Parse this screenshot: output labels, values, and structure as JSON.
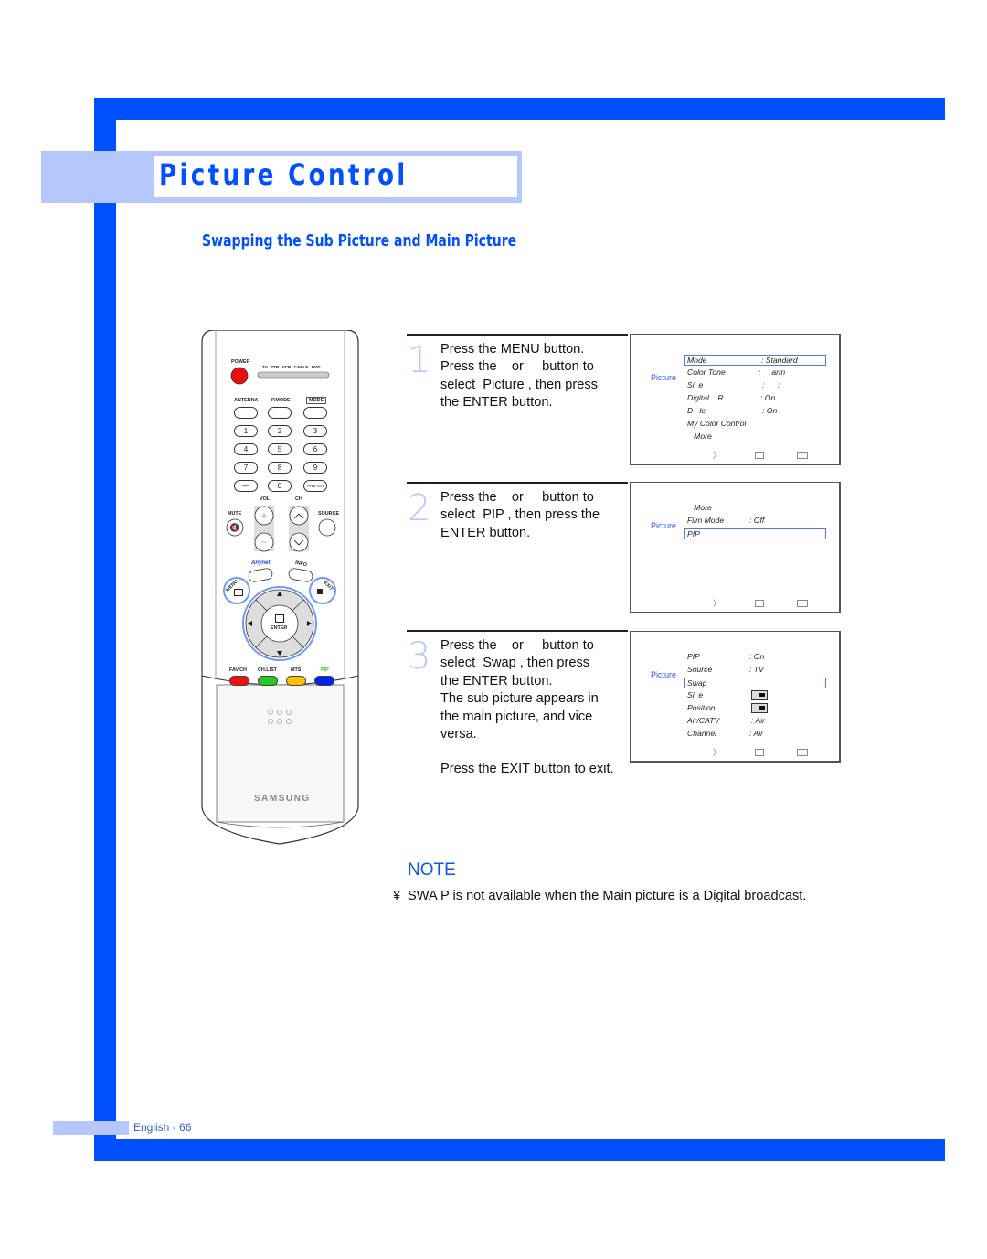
{
  "page": {
    "title": "Picture Control",
    "subtitle": "Swapping the Sub Picture and Main Picture",
    "footer": "English - 66",
    "colors": {
      "accent_blue": "#0050ff",
      "light_blue": "#b6c7fd",
      "menu_category": "#2e5be8"
    }
  },
  "steps": [
    {
      "number": "1",
      "text": [
        "Press the MENU button.",
        "Press the    or     button to",
        "select  Picture , then press",
        "the ENTER button."
      ]
    },
    {
      "number": "2",
      "text": [
        "Press the    or     button to",
        "select  PIP , then press the",
        "ENTER button."
      ]
    },
    {
      "number": "3",
      "text": [
        "Press the    or     button to",
        "select  Swap , then press",
        "the ENTER button.",
        "The sub picture appears in",
        "the main picture, and vice",
        "versa."
      ]
    }
  ],
  "exit_text": "Press the EXIT button to exit.",
  "osd_menus": [
    {
      "category": "Picture",
      "rows": [
        {
          "label": "Mode",
          "value": ": Standard",
          "selected": true
        },
        {
          "label": "Color Tone",
          "value": ":     arm"
        },
        {
          "label": "Si  e",
          "value": ":      :"
        },
        {
          "label": "Digital    R",
          "value": ": On"
        },
        {
          "label": "D   le",
          "value": ": On"
        },
        {
          "label": "My Color Control",
          "value": ""
        },
        {
          "label": "   More",
          "value": ""
        }
      ],
      "nav": [
        "move-icon",
        "enter-icon",
        "return-icon"
      ]
    },
    {
      "category": "Picture",
      "rows": [
        {
          "label": "   More",
          "value": ""
        },
        {
          "label": "Film Mode",
          "value": ": Off"
        },
        {
          "label": "PIP",
          "value": "",
          "selected": true
        }
      ],
      "nav": [
        "move-icon",
        "enter-icon",
        "return-icon"
      ]
    },
    {
      "category": "Picture",
      "rows": [
        {
          "label": "PIP",
          "value": ": On"
        },
        {
          "label": "Source",
          "value": ": TV"
        },
        {
          "label": "Swap",
          "value": "",
          "selected": true
        },
        {
          "label": "Si  e",
          "value": "[pip-size-icon]"
        },
        {
          "label": "Position",
          "value": "[pip-position-icon]"
        },
        {
          "label": "Air/CATV",
          "value": ": Air"
        },
        {
          "label": "Channel",
          "value": ": Air"
        }
      ],
      "nav": [
        "move-icon",
        "enter-icon",
        "return-icon"
      ]
    }
  ],
  "note": {
    "title": "NOTE",
    "bullet": "¥",
    "text": "SWA P is not available when the Main picture is a Digital broadcast."
  },
  "remote": {
    "brand": "SAMSUNG",
    "power_label": "POWER",
    "modes": [
      "TV",
      "STB",
      "VCR",
      "CABLE",
      "DVD"
    ],
    "top_labels": [
      "ANTENNA",
      "P.MODE",
      "MODE"
    ],
    "keypad": [
      "1",
      "2",
      "3",
      "4",
      "5",
      "6",
      "7",
      "8",
      "9",
      "—",
      "0",
      "PRE-CH"
    ],
    "vol_label": "VOL",
    "ch_label": "CH",
    "mute_label": "MUTE",
    "source_label": "SOURCE",
    "anynet_label": "Anynet",
    "info_label": "INFO",
    "menu_label": "MENU",
    "exit_label": "EXIT",
    "enter_label": "ENTER",
    "color_labels": [
      "FAV.CH",
      "CH.LIST",
      "MTS",
      "PIP"
    ],
    "color_buttons": [
      "#ee1111",
      "#22cc22",
      "#ffc000",
      "#0022ee"
    ]
  }
}
